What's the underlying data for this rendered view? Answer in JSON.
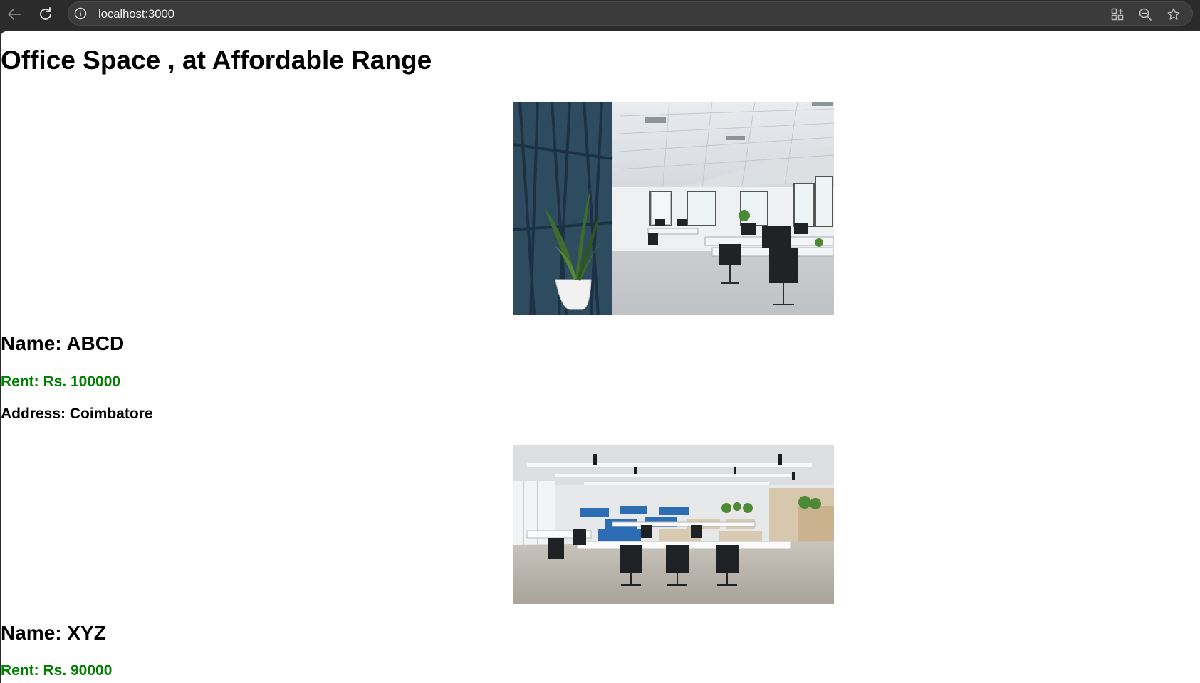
{
  "browser": {
    "url": "localhost:3000"
  },
  "page": {
    "title": "Office Space , at Affordable Range"
  },
  "listings": [
    {
      "name": "Name: ABCD",
      "rent": "Rent: Rs. 100000",
      "address": "Address: Coimbatore",
      "photo_alt": "office interior with plant and blue wall"
    },
    {
      "name": "Name: XYZ",
      "rent": "Rent: Rs. 90000"
    }
  ],
  "colors": {
    "rent": "#008000",
    "toolbar": "#2b2b2b"
  }
}
